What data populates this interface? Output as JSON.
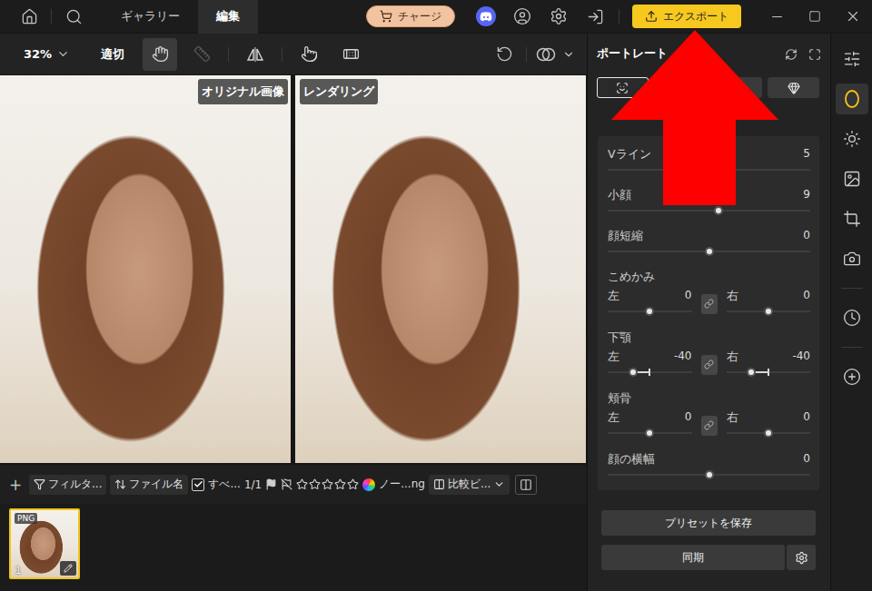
{
  "topbar": {
    "tabs": [
      {
        "label": "ギャラリー",
        "selected": false
      },
      {
        "label": "編集",
        "selected": true
      }
    ],
    "charge": "チャージ",
    "export": "エクスポート"
  },
  "toolbar": {
    "zoom": "32%",
    "fit": "適切",
    "tools": [
      {
        "selected": true,
        "disabled": false
      },
      {
        "selected": false,
        "disabled": true
      },
      {
        "selected": false,
        "disabled": false
      },
      {
        "selected": false,
        "disabled": false
      },
      {
        "selected": false,
        "disabled": false
      }
    ]
  },
  "canvas": {
    "panes": [
      {
        "label": "オリジナル画像"
      },
      {
        "label": "レンダリング"
      }
    ]
  },
  "filmstrip": {
    "add": "+",
    "filter": "フィルタ...",
    "sort": "ファイル名",
    "select_all": {
      "label": "すべ...",
      "checked": true
    },
    "count": "1/1",
    "stars": 0,
    "file": "ノー...ng",
    "compare": "比較ビ...",
    "thumbnails": [
      {
        "badge": "PNG",
        "index": "1",
        "selected": true
      }
    ]
  },
  "panel": {
    "title": "ポートレート",
    "tabs": [
      {
        "selected": true
      },
      {
        "selected": false
      },
      {
        "selected": false
      },
      {
        "selected": false
      }
    ],
    "sliders": [
      {
        "kind": "single",
        "label": "Vライン",
        "value": "5",
        "level": 0.525
      },
      {
        "kind": "single",
        "label": "小顔",
        "value": "9",
        "level": 0.545
      },
      {
        "kind": "single",
        "label": "顔短縮",
        "value": "0",
        "level": 0.5
      },
      {
        "kind": "pair",
        "label": "こめかみ",
        "left": {
          "label": "左",
          "value": "0",
          "level": 0.5
        },
        "right": {
          "label": "右",
          "value": "0",
          "level": 0.5
        }
      },
      {
        "kind": "pair",
        "label": "下顎",
        "left": {
          "label": "左",
          "value": "-40",
          "level": 0.3
        },
        "right": {
          "label": "右",
          "value": "-40",
          "level": 0.3
        }
      },
      {
        "kind": "pair",
        "label": "頬骨",
        "left": {
          "label": "左",
          "value": "0",
          "level": 0.5
        },
        "right": {
          "label": "右",
          "value": "0",
          "level": 0.5
        }
      },
      {
        "kind": "single",
        "label": "顔の横幅",
        "value": "0",
        "level": 0.5
      }
    ],
    "save": "プリセットを保存",
    "sync": "同期"
  },
  "rail": {
    "items": [
      {
        "selected": false
      },
      {
        "selected": true
      },
      {
        "selected": false
      },
      {
        "selected": false
      },
      {
        "selected": false
      },
      {
        "selected": false
      },
      {
        "selected": false
      },
      {
        "selected": false
      }
    ]
  }
}
